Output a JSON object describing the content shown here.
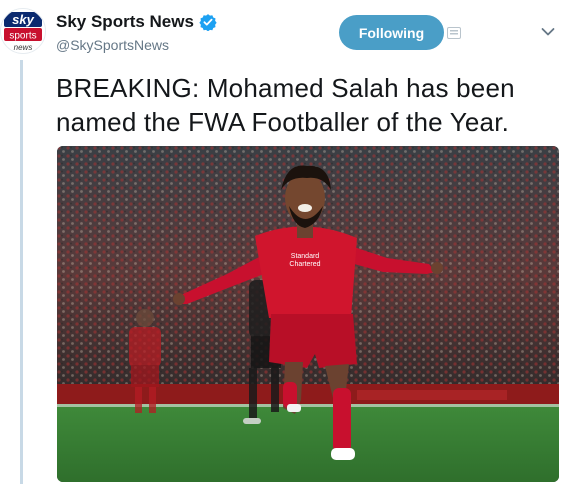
{
  "account": {
    "display_name": "Sky Sports News",
    "handle": "@SkySportsNews",
    "avatar_logo": {
      "line1": "sky",
      "line2": "sports",
      "line3": "news"
    },
    "verified": true
  },
  "follow_button": {
    "label": "Following"
  },
  "tweet": {
    "text": "BREAKING: Mohamed Salah has been named the FWA Footballer of the Year."
  },
  "media": {
    "sponsor_text": {
      "line1": "Standard",
      "line2": "Chartered"
    }
  },
  "icons": {
    "verified": "verified-badge-icon",
    "notifications": "notification-icon",
    "more": "chevron-down-icon"
  },
  "colors": {
    "follow_button": "#4a9ec7",
    "verified_badge": "#1da1f2",
    "thread_line": "#c8d9e6",
    "handle_text": "#657786",
    "brand_red": "#c8102e"
  }
}
